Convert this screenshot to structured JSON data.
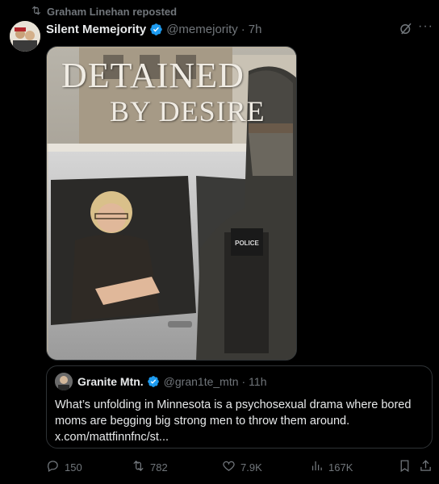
{
  "repost": {
    "label": "Graham Linehan reposted",
    "icon": "repost-icon"
  },
  "post": {
    "display_name": "Silent Memejority",
    "handle": "@memejority",
    "separator": "·",
    "time": "7h",
    "verified": true,
    "media": {
      "title_line1": "DETAINED",
      "title_line2": "BY DESIRE",
      "badge_text": "POLICE"
    }
  },
  "quote": {
    "display_name": "Granite Mtn.",
    "handle": "@gran1te_mtn",
    "separator": "·",
    "time": "11h",
    "verified": true,
    "text": "What’s unfolding in Minnesota is a psychosexual drama where bored moms are begging big strong men to throw them around.",
    "link": "x.com/mattfinnfnc/st..."
  },
  "actions": {
    "replies": "150",
    "reposts": "782",
    "likes": "7.9K",
    "views": "167K"
  },
  "colors": {
    "accent": "#1d9bf0",
    "muted": "#71767b",
    "text": "#e7e9ea",
    "border": "#2f3336",
    "background": "#000000"
  }
}
